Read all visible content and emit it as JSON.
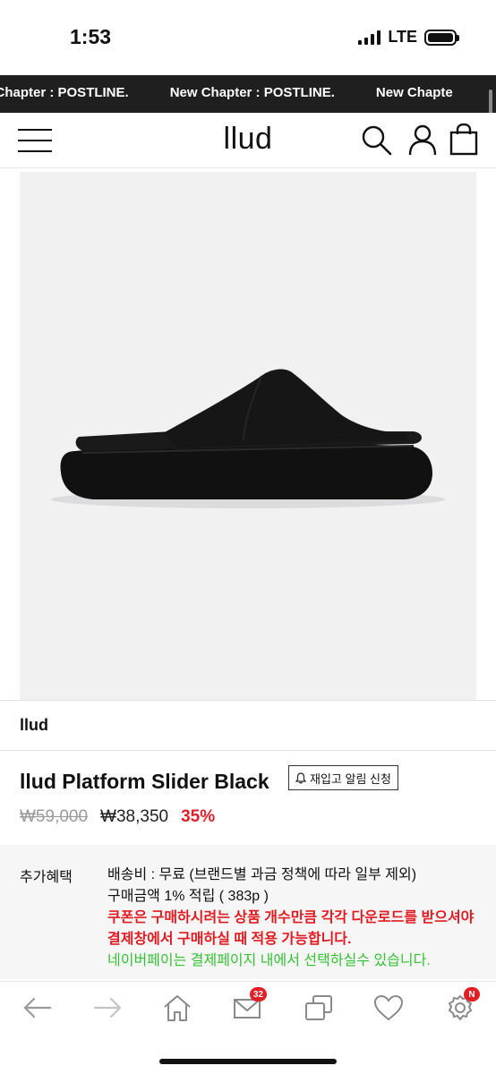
{
  "status_bar": {
    "time": "1:53",
    "network": "LTE",
    "battery_level": 1.0
  },
  "banner": {
    "items": [
      "y Chapter : POSTLINE.",
      "New Chapter : POSTLINE.",
      "New Chapte"
    ]
  },
  "header": {
    "logo": "llud"
  },
  "product": {
    "brand": "llud",
    "name": "llud Platform Slider Black",
    "restock_label": "재입고 알림 신청",
    "price_original": "₩59,000",
    "price_sale": "₩38,350",
    "discount": "35%"
  },
  "benefits": {
    "label": "추가혜택",
    "shipping": "배송비 : 무료 (브랜드별 과금 정책에 따라 일부 제외)",
    "points": "구매금액 1% 적립 ( 383p )",
    "coupon_notice": "쿠폰은 구매하시려는 상품 개수만큼 각각 다운로드를 받으셔야 결제창에서 구매하실 때 적용 가능합니다.",
    "naverpay_notice": "네이버페이는 결제페이지 내에서 선택하실수 있습니다."
  },
  "toolbar": {
    "mail_badge": "32",
    "settings_badge": "N"
  },
  "colors": {
    "banner_bg": "#1f1f1f",
    "discount": "#e0202a",
    "coupon": "#e11b22",
    "naverpay": "#35c235",
    "badge": "#e31e24"
  }
}
